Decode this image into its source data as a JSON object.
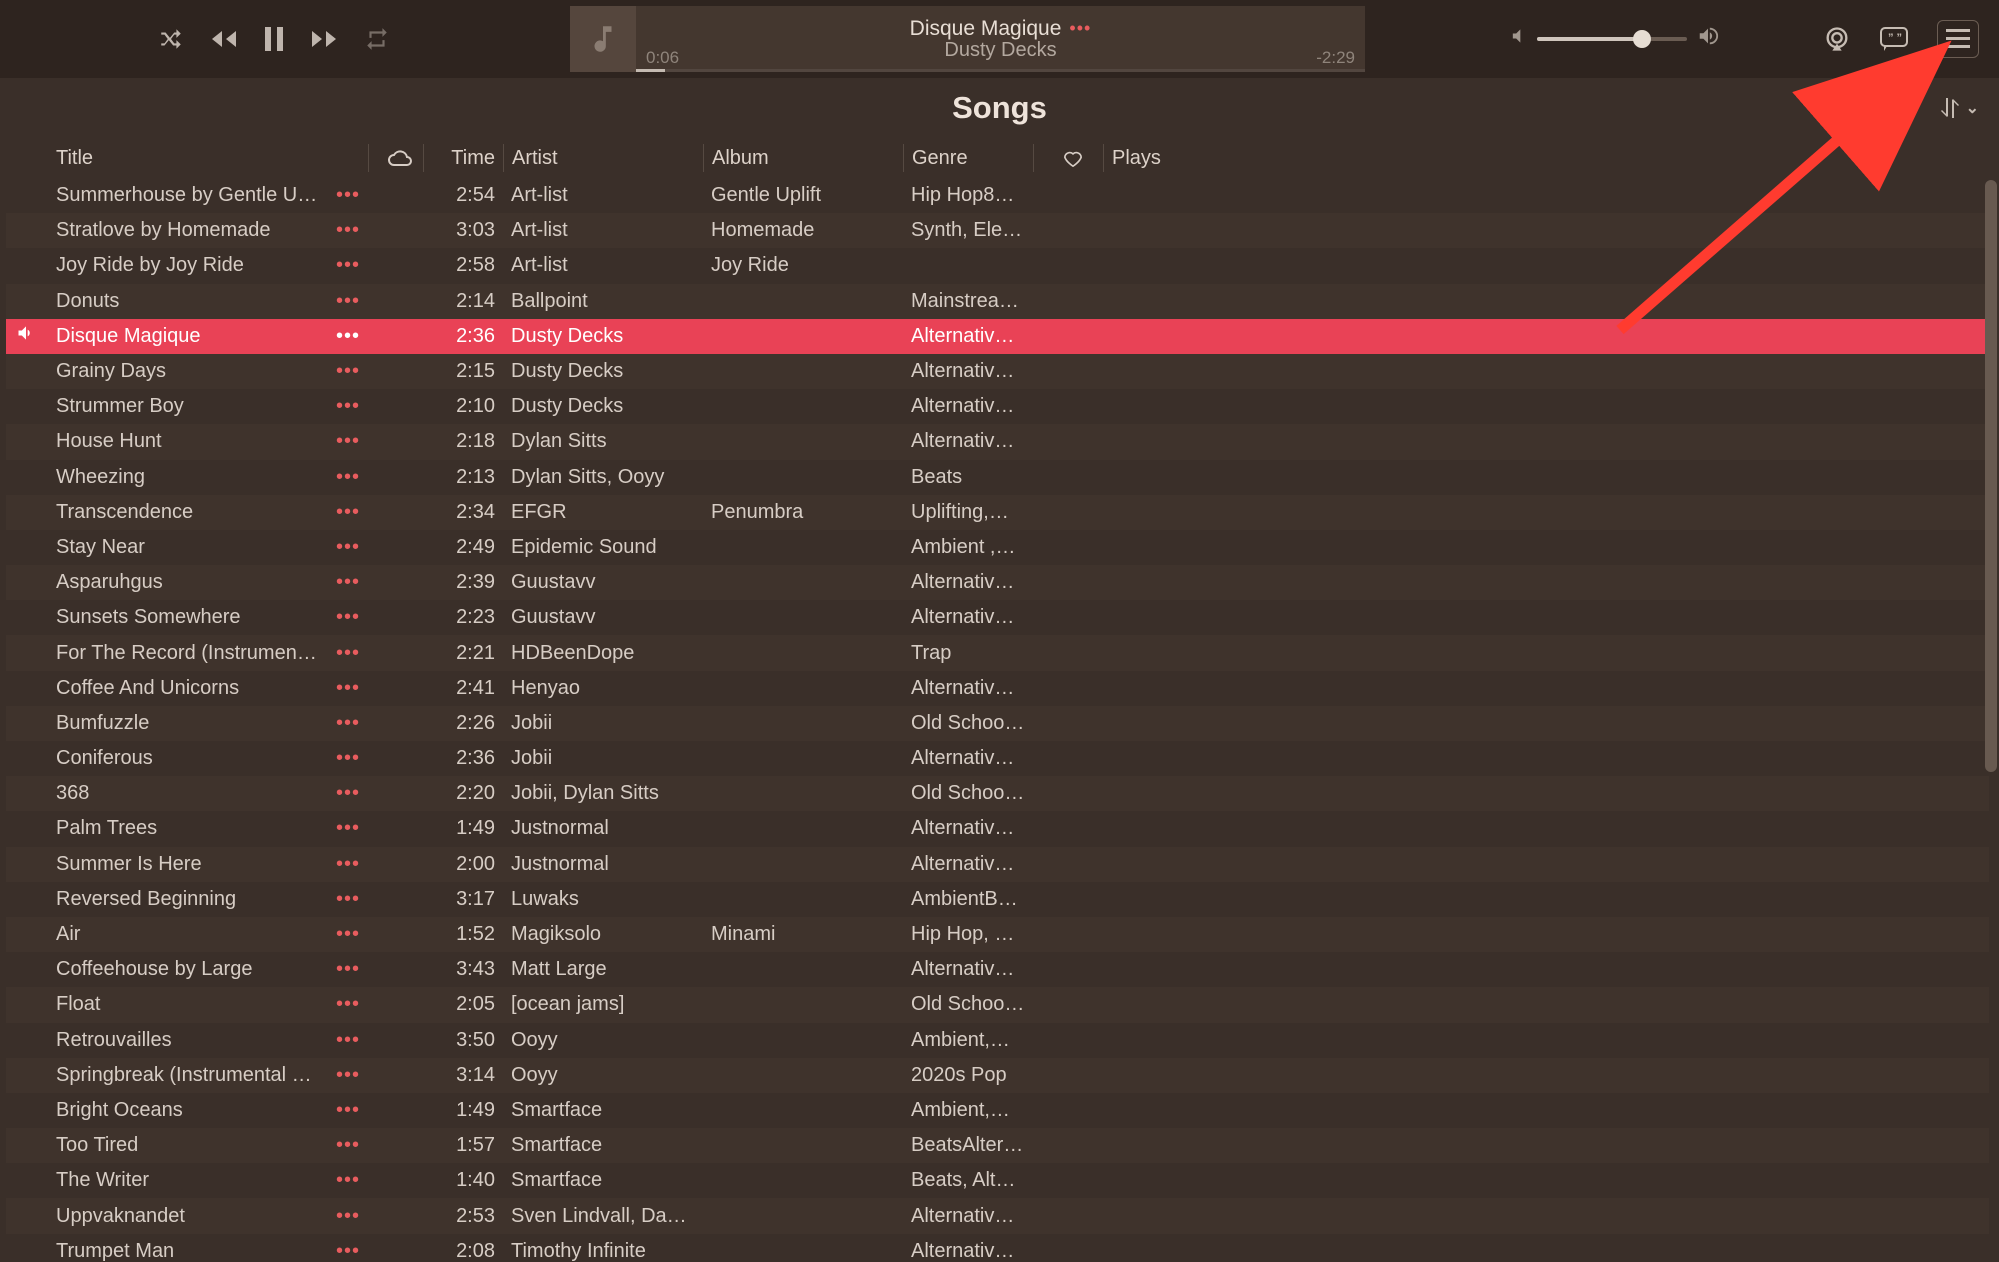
{
  "now_playing": {
    "title": "Disque Magique",
    "artist": "Dusty Decks",
    "elapsed": "0:06",
    "remaining": "-2:29"
  },
  "page_title": "Songs",
  "columns": {
    "title": "Title",
    "time": "Time",
    "artist": "Artist",
    "album": "Album",
    "genre": "Genre",
    "plays": "Plays"
  },
  "tracks": [
    {
      "title": "Summerhouse by Gentle Upl…",
      "time": "2:54",
      "artist": "Art-list",
      "album": "Gentle Uplift",
      "genre": "Hip Hop8L…"
    },
    {
      "title": "Stratlove by Homemade",
      "time": "3:03",
      "artist": "Art-list",
      "album": "Homemade",
      "genre": "Synth, Ele…"
    },
    {
      "title": "Joy Ride by Joy Ride",
      "time": "2:58",
      "artist": "Art-list",
      "album": "Joy Ride",
      "genre": ""
    },
    {
      "title": "Donuts",
      "time": "2:14",
      "artist": "Ballpoint",
      "album": "",
      "genre": "Mainstrea…"
    },
    {
      "title": "Disque Magique",
      "time": "2:36",
      "artist": "Dusty Decks",
      "album": "",
      "genre": "Alternative…",
      "playing": true
    },
    {
      "title": "Grainy Days",
      "time": "2:15",
      "artist": "Dusty Decks",
      "album": "",
      "genre": "Alternative…"
    },
    {
      "title": "Strummer Boy",
      "time": "2:10",
      "artist": "Dusty Decks",
      "album": "",
      "genre": "Alternative…"
    },
    {
      "title": "House Hunt",
      "time": "2:18",
      "artist": "Dylan Sitts",
      "album": "",
      "genre": "Alternative…"
    },
    {
      "title": "Wheezing",
      "time": "2:13",
      "artist": "Dylan Sitts, Ooyy",
      "album": "",
      "genre": "Beats"
    },
    {
      "title": "Transcendence",
      "time": "2:34",
      "artist": "EFGR",
      "album": "Penumbra",
      "genre": "Uplifting,…"
    },
    {
      "title": "Stay Near",
      "time": "2:49",
      "artist": "Epidemic Sound",
      "album": "",
      "genre": "Ambient ,…"
    },
    {
      "title": "Asparuhgus",
      "time": "2:39",
      "artist": "Guustavv",
      "album": "",
      "genre": "Alternative…"
    },
    {
      "title": "Sunsets Somewhere",
      "time": "2:23",
      "artist": "Guustavv",
      "album": "",
      "genre": "Alternative…"
    },
    {
      "title": "For The Record (Instrument…",
      "time": "2:21",
      "artist": "HDBeenDope",
      "album": "",
      "genre": "Trap"
    },
    {
      "title": "Coffee And Unicorns",
      "time": "2:41",
      "artist": "Henyao",
      "album": "",
      "genre": "Alternative…"
    },
    {
      "title": "Bumfuzzle",
      "time": "2:26",
      "artist": "Jobii",
      "album": "",
      "genre": "Old Schoo…"
    },
    {
      "title": "Coniferous",
      "time": "2:36",
      "artist": "Jobii",
      "album": "",
      "genre": "Alternative…"
    },
    {
      "title": "368",
      "time": "2:20",
      "artist": "Jobii, Dylan Sitts",
      "album": "",
      "genre": "Old Schoo…"
    },
    {
      "title": "Palm Trees",
      "time": "1:49",
      "artist": "Justnormal",
      "album": "",
      "genre": "Alternative…"
    },
    {
      "title": "Summer Is Here",
      "time": "2:00",
      "artist": "Justnormal",
      "album": "",
      "genre": "Alternative…"
    },
    {
      "title": "Reversed Beginning",
      "time": "3:17",
      "artist": "Luwaks",
      "album": "",
      "genre": "AmbientB…"
    },
    {
      "title": "Air",
      "time": "1:52",
      "artist": "Magiksolo",
      "album": "Minami",
      "genre": "Hip Hop, C…"
    },
    {
      "title": "Coffeehouse by Large",
      "time": "3:43",
      "artist": "Matt Large",
      "album": "",
      "genre": "Alternative…"
    },
    {
      "title": "Float",
      "time": "2:05",
      "artist": "[ocean jams]",
      "album": "",
      "genre": "Old Schoo…"
    },
    {
      "title": "Retrouvailles",
      "time": "3:50",
      "artist": "Ooyy",
      "album": "",
      "genre": "Ambient,…"
    },
    {
      "title": "Springbreak (Instrumental V…",
      "time": "3:14",
      "artist": "Ooyy",
      "album": "",
      "genre": "2020s Pop"
    },
    {
      "title": "Bright Oceans",
      "time": "1:49",
      "artist": "Smartface",
      "album": "",
      "genre": "Ambient,…"
    },
    {
      "title": "Too Tired",
      "time": "1:57",
      "artist": "Smartface",
      "album": "",
      "genre": "BeatsAlter…"
    },
    {
      "title": "The Writer",
      "time": "1:40",
      "artist": "Smartface",
      "album": "",
      "genre": "Beats, Alte…"
    },
    {
      "title": "Uppvaknandet",
      "time": "2:53",
      "artist": "Sven Lindvall, Dan…",
      "album": "",
      "genre": "Alternative…"
    },
    {
      "title": "Trumpet Man",
      "time": "2:08",
      "artist": "Timothy Infinite",
      "album": "",
      "genre": "Alternative…"
    }
  ]
}
